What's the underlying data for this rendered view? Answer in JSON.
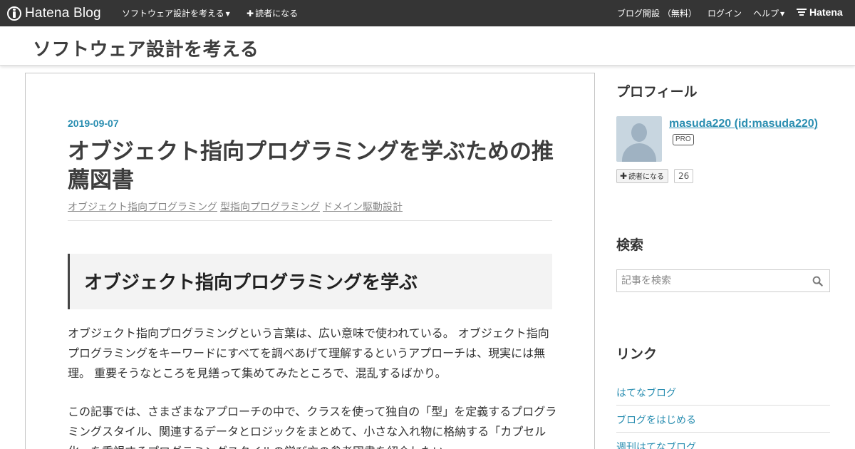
{
  "globalbar": {
    "brand": "Hatena Blog",
    "blog_menu": "ソフトウェア設計を考える",
    "subscribe": "読者になる",
    "open_blog": "ブログ開設 （無料）",
    "login": "ログイン",
    "help": "ヘルプ",
    "hatena": "Hatena"
  },
  "header": {
    "blog_title": "ソフトウェア設計を考える"
  },
  "entry": {
    "date": "2019-09-07",
    "title": "オブジェクト指向プログラミングを学ぶための推薦図書",
    "categories": [
      "オブジェクト指向プログラミング",
      "型指向プログラミング",
      "ドメイン駆動設計"
    ],
    "h3": "オブジェクト指向プログラミングを学ぶ",
    "para1": "オブジェクト指向プログラミングという言葉は、広い意味で使われている。 オブジェクト指向プログラミングをキーワードにすべてを調べあげて理解するというアプローチは、現実には無理。 重要そうなところを見繕って集めてみたところで、混乱するばかり。",
    "para2": "この記事では、さまざまなアプローチの中で、クラスを使って独自の「型」を定義するプログラミングスタイル、関連するデータとロジックをまとめて、小さな入れ物に格納する「カプセル化」を重視するプログラミングスタイルの学び方の参考図書を紹介したい。"
  },
  "sidebar": {
    "profile_heading": "プロフィール",
    "profile_name": "masuda220 (id:masuda220)",
    "pro_badge": "PRO",
    "subscribe_label": "読者になる",
    "subscriber_count": "26",
    "search_heading": "検索",
    "search_placeholder": "記事を検索",
    "links_heading": "リンク",
    "links": [
      "はてなブログ",
      "ブログをはじめる",
      "週刊はてなブログ"
    ]
  },
  "colors": {
    "topbar": "#353535",
    "accent": "#2a8eb1"
  }
}
